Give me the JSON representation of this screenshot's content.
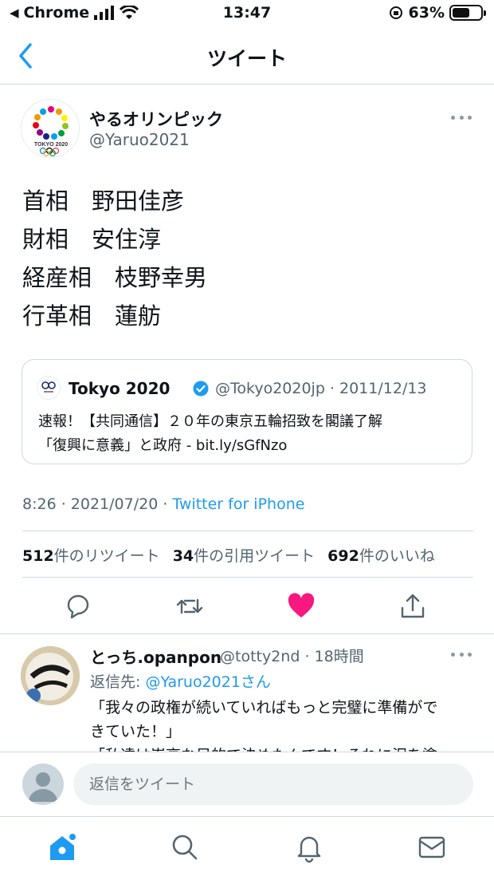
{
  "status_bar": {
    "carrier": "Chrome",
    "time": "13:47",
    "battery": "63%",
    "battery_level": 0.63
  },
  "header": {
    "title": "ツイート"
  },
  "tweet": {
    "display_name": "やるオリンピック",
    "handle": "@Yaruo2021",
    "body_lines": [
      "首相　野田佳彦",
      "財相　安住淳",
      "経産相　枝野幸男",
      "行革相　蓮舫"
    ],
    "timestamp": "8:26 · 2021/07/20 · ",
    "source": "Twitter for iPhone",
    "avatar_logo_text": "TOKYO 2020"
  },
  "quote": {
    "display_name": "Tokyo 2020",
    "meta": "@Tokyo2020jp · 2011/12/13",
    "line1": "速報！【共同通信】２０年の東京五輪招致を閣議了解",
    "line2": "「復興に意義」と政府 - bit.ly/sGfNzo"
  },
  "stats": {
    "retweets_count": "512",
    "retweets_label": "件のリツイート",
    "quotes_count": "34",
    "quotes_label": "件の引用ツイート",
    "likes_count": "692",
    "likes_label": "件のいいね"
  },
  "reply": {
    "display_name": "とっち.opanpon",
    "meta": "@totty2nd · 18時間",
    "reply_to_prefix": "返信先: ",
    "reply_to_handle": "@Yaruo2021さん",
    "text_line1": "「我々の政権が続いていればもっと完璧に準備がで",
    "text_line2": "きていた！」",
    "text_line3": "「私達は崇高な目的で決めたんです！それに泥を塗"
  },
  "reply_bar": {
    "placeholder": "返信をツイート"
  },
  "colors": {
    "accent": "#1d9bf0",
    "like": "#f91880",
    "secondary_text": "#536471",
    "border": "#cfd9de"
  }
}
